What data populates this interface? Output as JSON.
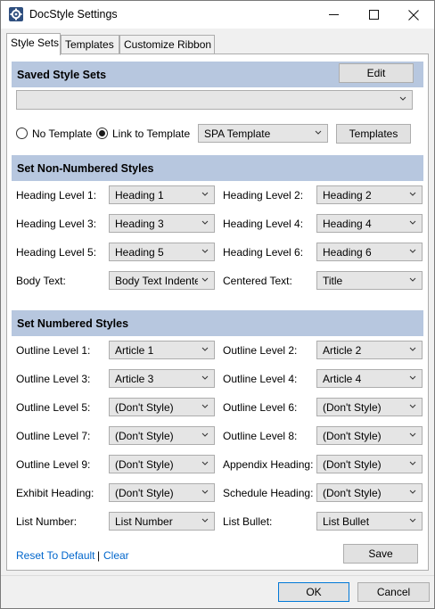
{
  "window": {
    "title": "DocStyle Settings"
  },
  "tabs": [
    {
      "label": "Style Sets"
    },
    {
      "label": "Templates"
    },
    {
      "label": "Customize Ribbon"
    }
  ],
  "saved_style_sets": {
    "header": "Saved Style Sets",
    "edit_button": "Edit",
    "selected": ""
  },
  "template_options": {
    "no_template": "No Template",
    "link_to_template": "Link to Template",
    "selected_option": "Link to Template",
    "template_select": "SPA Template",
    "templates_button": "Templates"
  },
  "non_numbered": {
    "header": "Set Non-Numbered Styles",
    "rows": [
      {
        "left_label": "Heading Level 1:",
        "left_value": "Heading 1",
        "right_label": "Heading Level 2:",
        "right_value": "Heading 2"
      },
      {
        "left_label": "Heading Level 3:",
        "left_value": "Heading 3",
        "right_label": "Heading Level 4:",
        "right_value": "Heading 4"
      },
      {
        "left_label": "Heading Level 5:",
        "left_value": "Heading 5",
        "right_label": "Heading Level 6:",
        "right_value": "Heading 6"
      },
      {
        "left_label": "Body Text:",
        "left_value": "Body Text Indented",
        "right_label": "Centered Text:",
        "right_value": "Title"
      }
    ]
  },
  "numbered": {
    "header": "Set Numbered Styles",
    "rows": [
      {
        "left_label": "Outline Level 1:",
        "left_value": "Article 1",
        "right_label": "Outline Level 2:",
        "right_value": "Article 2"
      },
      {
        "left_label": "Outline Level 3:",
        "left_value": "Article 3",
        "right_label": "Outline Level 4:",
        "right_value": "Article 4"
      },
      {
        "left_label": "Outline Level 5:",
        "left_value": "(Don't Style)",
        "right_label": "Outline Level 6:",
        "right_value": "(Don't Style)"
      },
      {
        "left_label": "Outline Level 7:",
        "left_value": "(Don't Style)",
        "right_label": "Outline Level 8:",
        "right_value": "(Don't Style)"
      },
      {
        "left_label": "Outline Level 9:",
        "left_value": "(Don't Style)",
        "right_label": "Appendix Heading:",
        "right_value": "(Don't Style)"
      },
      {
        "left_label": "Exhibit Heading:",
        "left_value": "(Don't Style)",
        "right_label": "Schedule Heading:",
        "right_value": "(Don't Style)"
      },
      {
        "left_label": "List Number:",
        "left_value": "List Number",
        "right_label": "List Bullet:",
        "right_value": "List Bullet"
      }
    ]
  },
  "bottom_links": {
    "reset": "Reset To Default",
    "separator": "|",
    "clear": "Clear"
  },
  "buttons": {
    "save": "Save",
    "ok": "OK",
    "cancel": "Cancel"
  },
  "colors": {
    "section_header_bg": "#b7c7df",
    "link": "#0066cc",
    "focus_border": "#0078d7"
  }
}
